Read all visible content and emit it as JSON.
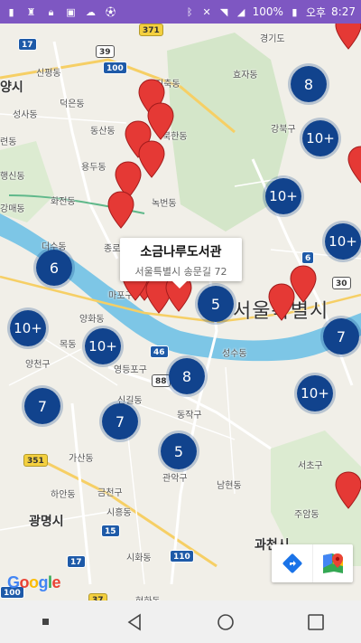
{
  "status_bar": {
    "battery_pct": "100%",
    "ampm": "오후",
    "time": "8:27",
    "icons": [
      "app-icon",
      "person-icon",
      "lock-icon",
      "image-icon",
      "cloud-icon",
      "soccer-icon",
      "bluetooth-icon",
      "mute-icon",
      "wifi-icon",
      "signal-icon",
      "battery-icon"
    ]
  },
  "map": {
    "place_labels": {
      "yangsi": "양시",
      "sinpyeong": "신평동",
      "deokeun": "덕은동",
      "seongsa": "성사동",
      "ryeondong": "련동",
      "dongsan": "동산동",
      "yongdu": "용두동",
      "haengsin": "행신동",
      "hwajeon": "화전동",
      "gangmae": "강매동",
      "jichuk": "지축동",
      "bukhan": "북한동",
      "hyoja": "효자동",
      "gangbuk": "강북구",
      "nokbeon": "녹번동",
      "jongno": "종로구",
      "gyeonggido": "경기도",
      "seoul_city": "서울특별시",
      "deoksu": "더수동",
      "mapo": "마포구",
      "yanghwa": "양화동",
      "mokdong": "목동",
      "yangcheon": "양천구",
      "yeongdeungpo": "영등포구",
      "seongsu": "성수동",
      "singil": "신길동",
      "dongjak": "동작구",
      "gwanak": "관악구",
      "gasan": "가산동",
      "geumcheon": "금천구",
      "siheung": "시흥동",
      "hahan": "하안동",
      "gwangmyeong": "광명시",
      "sihwa": "시화동",
      "namhyeon": "남현동",
      "juam": "주암동",
      "seocho": "서초구",
      "gwacheon": "과천시",
      "hyeonhwa": "현화동"
    },
    "road_shields": {
      "r17a": "17",
      "r39": "39",
      "r371": "371",
      "r100a": "100",
      "r6": "6",
      "r30": "30",
      "r46": "46",
      "r88": "88",
      "r351": "351",
      "r15": "15",
      "r17b": "17",
      "r110": "110",
      "r100b": "100",
      "r37": "37"
    },
    "clusters": [
      {
        "label": "8"
      },
      {
        "label": "10+"
      },
      {
        "label": "10+"
      },
      {
        "label": "10+"
      },
      {
        "label": "6"
      },
      {
        "label": "5"
      },
      {
        "label": "10+"
      },
      {
        "label": "10+"
      },
      {
        "label": "7"
      },
      {
        "label": "8"
      },
      {
        "label": "10+"
      },
      {
        "label": "7"
      },
      {
        "label": "7"
      },
      {
        "label": "5"
      }
    ],
    "info_window": {
      "title": "소금나루도서관",
      "address": "서울특별시 송문길 72"
    },
    "google_logo": "Google",
    "colors": {
      "cluster": "#11438d",
      "marker": "#e53935",
      "status_bar": "#7e57c2",
      "water": "#7dc6e6"
    }
  },
  "toolbar": {
    "directions_icon": "directions-icon",
    "maps_icon": "google-maps-icon"
  },
  "nav_bar": {
    "icons": [
      "overview-square-icon",
      "back-triangle-icon",
      "home-circle-icon",
      "recents-square-icon"
    ]
  }
}
